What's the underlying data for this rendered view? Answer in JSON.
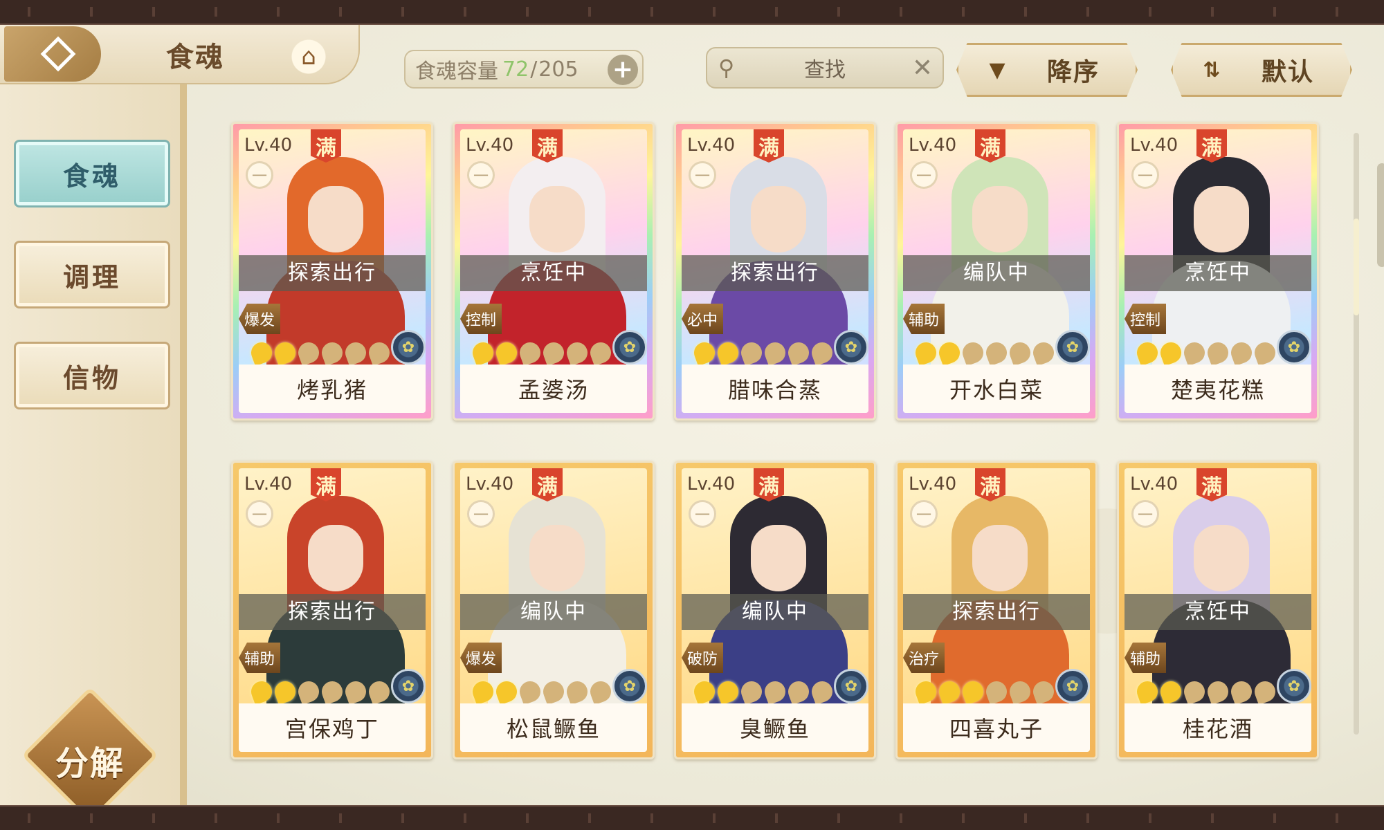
{
  "header": {
    "title": "食魂",
    "capacity_label": "食魂容量",
    "capacity_current": "72",
    "capacity_sep": "/",
    "capacity_max": "205",
    "capacity_add": "+",
    "search_placeholder": "查找",
    "sort_order_label": "降序",
    "sort_mode_label": "默认"
  },
  "sidebar": {
    "items": [
      {
        "label": "食魂",
        "active": true
      },
      {
        "label": "调理",
        "active": false
      },
      {
        "label": "信物",
        "active": false
      }
    ],
    "decompose_label": "分解"
  },
  "card_common": {
    "level": "Lv.40",
    "full_badge": "满",
    "bowl_glyph": "一"
  },
  "cards": [
    {
      "name": "烤乳猪",
      "status": "探索出行",
      "role": "爆发",
      "stars": 2,
      "frame": "rainbow",
      "hair": "#e2692b",
      "outfit": "#c23a2a"
    },
    {
      "name": "孟婆汤",
      "status": "烹饪中",
      "role": "控制",
      "stars": 2,
      "frame": "rainbow",
      "hair": "#f3eef0",
      "outfit": "#c2232b"
    },
    {
      "name": "腊味合蒸",
      "status": "探索出行",
      "role": "必中",
      "stars": 2,
      "frame": "rainbow",
      "hair": "#d9dde6",
      "outfit": "#6b4aa6"
    },
    {
      "name": "开水白菜",
      "status": "编队中",
      "role": "辅助",
      "stars": 2,
      "frame": "rainbow",
      "hair": "#cfe4b8",
      "outfit": "#f2f1ea"
    },
    {
      "name": "楚夷花糕",
      "status": "烹饪中",
      "role": "控制",
      "stars": 2,
      "frame": "rainbow",
      "hair": "#2b2b33",
      "outfit": "#eef0f2"
    },
    {
      "name": "宫保鸡丁",
      "status": "探索出行",
      "role": "辅助",
      "stars": 2,
      "frame": "gold",
      "hair": "#c9442a",
      "outfit": "#2c3b3a"
    },
    {
      "name": "松鼠鳜鱼",
      "status": "编队中",
      "role": "爆发",
      "stars": 2,
      "frame": "gold",
      "hair": "#e6e2d4",
      "outfit": "#f3efe4"
    },
    {
      "name": "臭鳜鱼",
      "status": "编队中",
      "role": "破防",
      "stars": 2,
      "frame": "gold",
      "hair": "#2d2a33",
      "outfit": "#3b3f86"
    },
    {
      "name": "四喜丸子",
      "status": "探索出行",
      "role": "治疗",
      "stars": 3,
      "frame": "gold",
      "hair": "#e7b866",
      "outfit": "#e06b2d"
    },
    {
      "name": "桂花酒",
      "status": "烹饪中",
      "role": "辅助",
      "stars": 2,
      "frame": "gold",
      "hair": "#d9cdea",
      "outfit": "#2d2b36"
    }
  ]
}
